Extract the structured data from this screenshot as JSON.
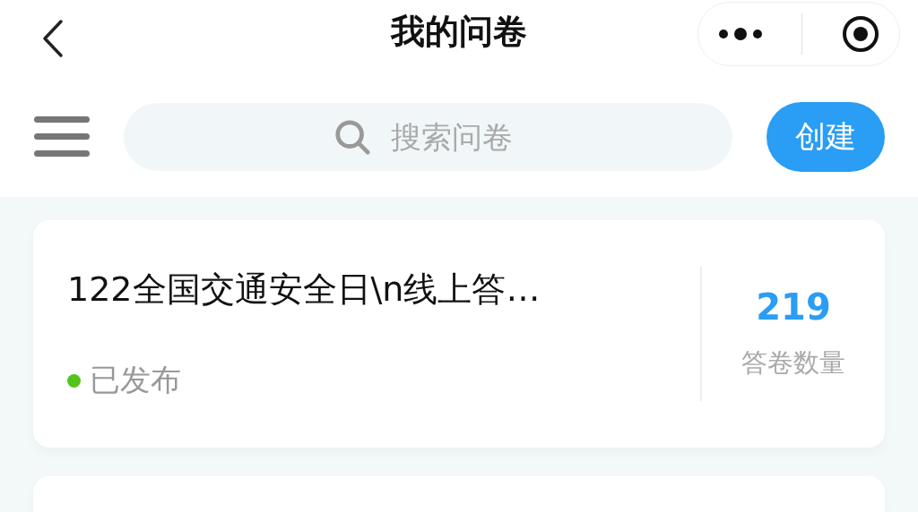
{
  "nav_bar": {
    "title": "我的问卷"
  },
  "toolbar": {
    "search": {
      "placeholder": "搜索问卷"
    },
    "create_button": "创建"
  },
  "surveys": [
    {
      "title": "122全国交通安全日\\n线上答…",
      "status": "已发布",
      "color": "#52c41a",
      "count": "219",
      "count_label": "答卷数量"
    }
  ]
}
